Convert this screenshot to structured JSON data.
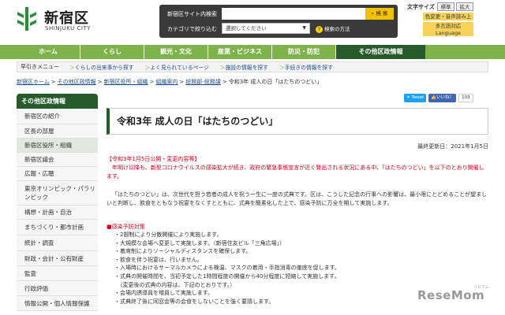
{
  "header": {
    "logo_title": "新宿区",
    "logo_sub": "SHINJUKU CITY",
    "search": {
      "label_site": "新宿区サイト内検索",
      "search_button": "検 索",
      "label_category": "カテゴリで絞り込む",
      "category_selected": "選択してください",
      "help_link": "検索の方法"
    },
    "text_size": {
      "label": "文字サイズ",
      "standard": "標準",
      "large": "拡大"
    },
    "color_voice_link": "色変更・音声読み上げ",
    "language_link_line1": "多言語対応",
    "language_link_line2": "Language"
  },
  "gnav": {
    "items": [
      "ホーム",
      "くらし",
      "観光・文化",
      "産業・ビジネス",
      "防災・防犯",
      "その他区政情報"
    ]
  },
  "subnav": {
    "title": "早引きメニュー",
    "links": [
      "くらしの出来事から探す",
      "よく見られているページ",
      "施設の情報を探す",
      "手続きの情報を探す"
    ]
  },
  "breadcrumb": {
    "items": [
      "新宿区ホーム",
      "その他区政情報",
      "新宿区役所・組織",
      "組織案内",
      "総務部-総務課"
    ],
    "current": "令和3年 成人の日「はたちのつどい」"
  },
  "sidebar": {
    "heading": "その他区政情報",
    "items": [
      "新宿区の紹介",
      "区長の部屋",
      "新宿区役所・組織",
      "新宿区議会",
      "広報・広聴",
      "東京オリンピック・パラリンピック",
      "構想・計画・自治",
      "まちづくり・都市計画",
      "統計・調査",
      "財政・会計・公有財産",
      "監査",
      "行政評価",
      "情報公開・個人情報保護"
    ]
  },
  "social": {
    "tweet": "Tweet",
    "like": "いいね！",
    "like_count": "103"
  },
  "main": {
    "title": "令和3年 成人の日「はたちのつどい」",
    "updated": "最終更新日：2021年1月5日",
    "notice_heading": "【令和3年1月5日公開・変更内容等】",
    "notice_body": "年明け以降も、新型コロナウイルスの感染拡大が続き、政府の緊急事態宣言が近く発出される状況にある中、「はたちのつどい」を以下のとおり開催します。",
    "intro": "「はたちのつどい」は、次世代を担う若者の成人を祝う一生に一度の式典です。区は、こうした記念の行事への影響は、最小限にとどめることが望ましいと判断し、飲食をともなう祝宴をなくすとともに、式典を簡素化した上で、感染予防に万全を期して実施します。",
    "measures_title": "■感染予防対策",
    "measures": [
      "・2部制により分散開催により実施します。",
      "・大規模な会場へ変更して実施します。（新宿住友ビル「三角広場」）",
      "・着席制によりソーシャルディスタンスを確保します。",
      "・飲食を伴う祝宴は、行いません。",
      "・入場時におけるサーマルカメラによる検温、マスクの着用・手指消毒の徹底を促します。",
      "・式典の開催時間を、当初予定した1時間程度の開催から40分程度に短縮して実施します。",
      "　（変更後の式典の内容は、下記のとおりです。）",
      "・会場内誘導員を増員して実施します。",
      "・式典終了後に同窓会等の会食をしないことを強く要請します。"
    ]
  },
  "watermark": {
    "text": "ReseMom",
    "sub": "リセマム"
  },
  "colors": {
    "nav_green": "#7eb34c",
    "dark_green": "#285b2b",
    "notice_red": "#d0021b",
    "link_blue": "#1d4f91",
    "accent_yellow": "#f7d35a"
  }
}
